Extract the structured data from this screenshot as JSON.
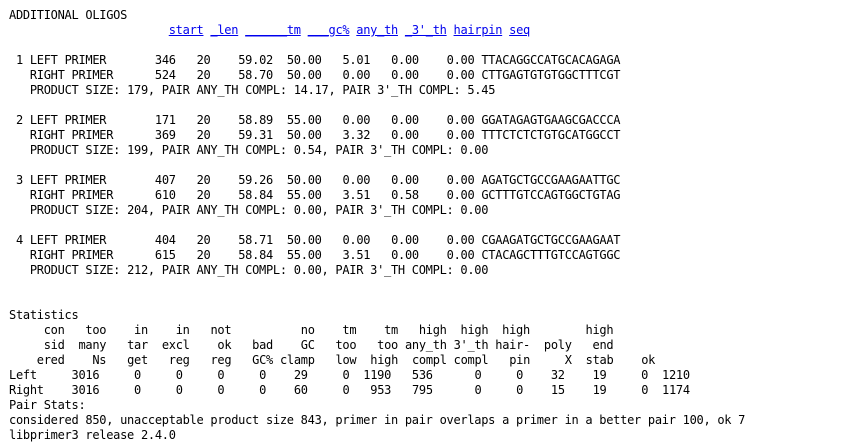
{
  "title": "ADDITIONAL OLIGOS",
  "columns": [
    {
      "label": "start",
      "w": 5
    },
    {
      "label": "len",
      "w": 4
    },
    {
      "label": "tm",
      "w": 8
    },
    {
      "label": "gc%",
      "w": 6
    },
    {
      "label": "any_th",
      "w": 6
    },
    {
      "label": "3'_th",
      "w": 6
    },
    {
      "label": "hairpin",
      "w": 7
    },
    {
      "label": "seq",
      "w": 3
    }
  ],
  "oligos": [
    {
      "num": "1",
      "left": {
        "type": "LEFT PRIMER",
        "start": "346",
        "len": "20",
        "tm": "59.02",
        "gc": "50.00",
        "any_th": "5.01",
        "th3": "0.00",
        "hairpin": "0.00",
        "seq": "TTACAGGCCATGCACAGAGA"
      },
      "right": {
        "type": "RIGHT PRIMER",
        "start": "524",
        "len": "20",
        "tm": "58.70",
        "gc": "50.00",
        "any_th": "0.00",
        "th3": "0.00",
        "hairpin": "0.00",
        "seq": "CTTGAGTGTGTGGCTTTCGT"
      },
      "product": "PRODUCT SIZE: 179, PAIR ANY_TH COMPL: 14.17, PAIR 3'_TH COMPL: 5.45"
    },
    {
      "num": "2",
      "left": {
        "type": "LEFT PRIMER",
        "start": "171",
        "len": "20",
        "tm": "58.89",
        "gc": "55.00",
        "any_th": "0.00",
        "th3": "0.00",
        "hairpin": "0.00",
        "seq": "GGATAGAGTGAAGCGACCCA"
      },
      "right": {
        "type": "RIGHT PRIMER",
        "start": "369",
        "len": "20",
        "tm": "59.31",
        "gc": "50.00",
        "any_th": "3.32",
        "th3": "0.00",
        "hairpin": "0.00",
        "seq": "TTTCTCTCTGTGCATGGCCT"
      },
      "product": "PRODUCT SIZE: 199, PAIR ANY_TH COMPL: 0.54, PAIR 3'_TH COMPL: 0.00"
    },
    {
      "num": "3",
      "left": {
        "type": "LEFT PRIMER",
        "start": "407",
        "len": "20",
        "tm": "59.26",
        "gc": "50.00",
        "any_th": "0.00",
        "th3": "0.00",
        "hairpin": "0.00",
        "seq": "AGATGCTGCCGAAGAATTGC"
      },
      "right": {
        "type": "RIGHT PRIMER",
        "start": "610",
        "len": "20",
        "tm": "58.84",
        "gc": "55.00",
        "any_th": "3.51",
        "th3": "0.58",
        "hairpin": "0.00",
        "seq": "GCTTTGTCCAGTGGCTGTAG"
      },
      "product": "PRODUCT SIZE: 204, PAIR ANY_TH COMPL: 0.00, PAIR 3'_TH COMPL: 0.00"
    },
    {
      "num": "4",
      "left": {
        "type": "LEFT PRIMER",
        "start": "404",
        "len": "20",
        "tm": "58.71",
        "gc": "50.00",
        "any_th": "0.00",
        "th3": "0.00",
        "hairpin": "0.00",
        "seq": "CGAAGATGCTGCCGAAGAAT"
      },
      "right": {
        "type": "RIGHT PRIMER",
        "start": "615",
        "len": "20",
        "tm": "58.84",
        "gc": "55.00",
        "any_th": "3.51",
        "th3": "0.00",
        "hairpin": "0.00",
        "seq": "CTACAGCTTTGTCCAGTGGC"
      },
      "product": "PRODUCT SIZE: 212, PAIR ANY_TH COMPL: 0.00, PAIR 3'_TH COMPL: 0.00"
    }
  ],
  "statistics": {
    "title": "Statistics",
    "header_rows": [
      [
        "con",
        "too",
        "in",
        "in",
        "not",
        "",
        "no",
        "tm",
        "tm",
        "high",
        "high",
        "high",
        "",
        "high",
        ""
      ],
      [
        "sid",
        "many",
        "tar",
        "excl",
        "ok",
        "bad",
        "GC",
        "too",
        "too",
        "any_th",
        "3'_th",
        "hair-",
        "poly",
        "end",
        ""
      ],
      [
        "ered",
        "Ns",
        "get",
        "reg",
        "reg",
        "GC%",
        "clamp",
        "low",
        "high",
        "compl",
        "compl",
        "pin",
        "X",
        "stab",
        "ok"
      ]
    ],
    "rows": [
      {
        "label": "Left",
        "values": [
          "3016",
          "0",
          "0",
          "0",
          "0",
          "29",
          "0",
          "1190",
          "536",
          "0",
          "0",
          "32",
          "19",
          "0",
          "1210"
        ]
      },
      {
        "label": "Right",
        "values": [
          "3016",
          "0",
          "0",
          "0",
          "0",
          "60",
          "0",
          "953",
          "795",
          "0",
          "0",
          "15",
          "19",
          "0",
          "1174"
        ]
      }
    ]
  },
  "pair_stats": {
    "title": "Pair Stats:",
    "text": "considered 850, unacceptable product size 843, primer in pair overlaps a primer in a better pair 100, ok 7"
  },
  "release": "libprimer3 release 2.4.0"
}
